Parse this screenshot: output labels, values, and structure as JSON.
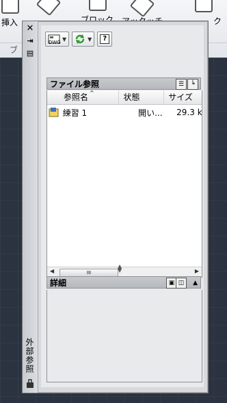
{
  "ribbon": {
    "labels": [
      "挿入",
      "ブロック",
      "アッタッチ",
      "ク",
      "ブ"
    ]
  },
  "palette": {
    "side_title": "外部参照",
    "close_glyph": "✕",
    "autohide_glyph": "⇥",
    "props_glyph": "▤",
    "toolbar": {
      "attach_label": "DWG",
      "help_glyph": "?"
    },
    "file_refs": {
      "title": "ファイル参照",
      "columns": [
        "参照名",
        "状態",
        "サイズ"
      ],
      "rows": [
        {
          "name": "練習 1",
          "status": "開い...",
          "size": "29.3 k"
        }
      ],
      "scroll_thumb": "III"
    },
    "details": {
      "title": "詳細"
    }
  }
}
